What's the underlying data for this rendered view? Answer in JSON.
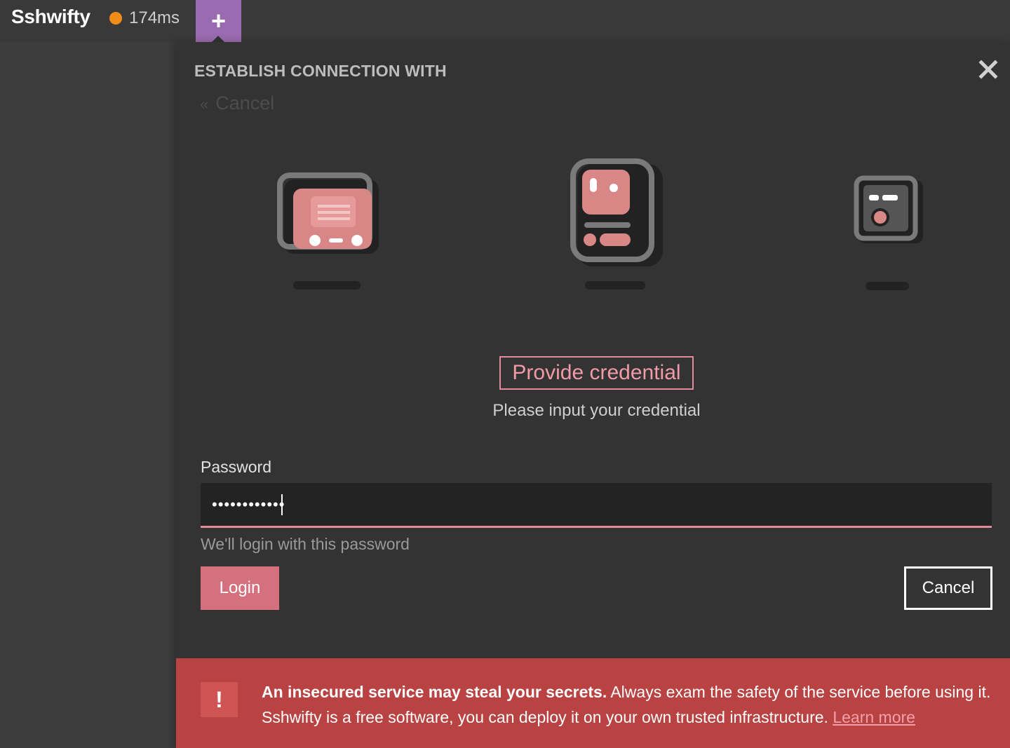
{
  "app": {
    "title": "Sshwifty",
    "latency": "174ms",
    "add_tab_symbol": "+",
    "status_color": "#f08c1a"
  },
  "dialog": {
    "title": "ESTABLISH CONNECTION WITH",
    "close_symbol": "×",
    "back_symbol": "«",
    "back_label": "Cancel"
  },
  "step": {
    "title": "Provide credential",
    "description": "Please input your credential"
  },
  "password_field": {
    "label": "Password",
    "value": "••••••••••••",
    "hint": "We'll login with this password"
  },
  "actions": {
    "login_label": "Login",
    "cancel_label": "Cancel"
  },
  "warning": {
    "icon": "!",
    "bold_text": "An insecured service may steal your secrets.",
    "text": " Always exam the safety of the service before using it. Sshwifty is a free software, you can deploy it on your own trusted infrastructure. ",
    "link_text": "Learn more"
  },
  "colors": {
    "accent": "#e28a9a",
    "tab_purple": "#9a6bb0",
    "warning_red": "#b94242"
  }
}
